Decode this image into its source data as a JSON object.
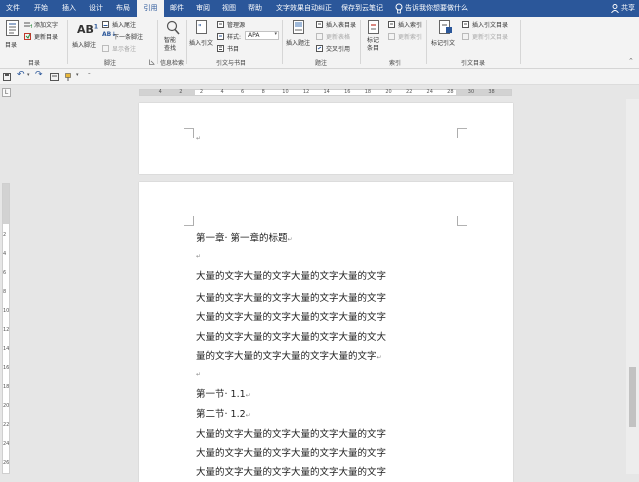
{
  "tabs": [
    "文件",
    "开始",
    "插入",
    "设计",
    "布局",
    "引用",
    "邮件",
    "审阅",
    "视图",
    "帮助",
    "文字效果自动纠正",
    "保存到云笔记"
  ],
  "active_tab": "引用",
  "tell_me": "告诉我你想要做什么",
  "share": "共享",
  "ribbon": {
    "toc": {
      "big": "目录",
      "add_text": "添加文字",
      "update": "更新目录",
      "group": "目录"
    },
    "footnotes": {
      "insert_footnote": "插入脚注",
      "ab_label": "AB",
      "ab_sup": "1",
      "insert_endnote": "插入尾注",
      "next_footnote": "下一条脚注",
      "show_notes": "显示备注",
      "group": "脚注"
    },
    "research": {
      "smart_lookup": "智能查找",
      "group": "信息检索"
    },
    "citations": {
      "insert_citation": "插入引文",
      "manage_sources": "管理源",
      "style_label": "样式:",
      "style_value": "APA",
      "bibliography": "书目",
      "group": "引文与书目"
    },
    "captions": {
      "insert_caption": "插入题注",
      "insert_table_of_figures": "插入表目录",
      "update_table": "更新表格",
      "cross_reference": "交叉引用",
      "group": "题注"
    },
    "index": {
      "mark_entry": "标记条目",
      "insert_index": "插入索引",
      "update_index": "更新索引",
      "group": "索引"
    },
    "toa": {
      "mark_citation": "标记引文",
      "insert_toa": "插入引文目录",
      "update_toa": "更新引文目录",
      "group": "引文目录"
    }
  },
  "ruler_numbers": [
    "4",
    "2",
    "2",
    "4",
    "6",
    "8",
    "10",
    "12",
    "14",
    "16",
    "18",
    "20",
    "22",
    "24",
    "28",
    "30",
    "38"
  ],
  "vruler_numbers": [
    "2",
    "4",
    "6",
    "8",
    "10",
    "12",
    "14",
    "16",
    "18",
    "20",
    "22",
    "24",
    "26"
  ],
  "document": {
    "para_mark": "↵",
    "chapter": "第一章· 第一章的标题",
    "body_line": "大量的文字大量的文字大量的文字大量的文字",
    "body_line_b": "大量的文字大量的文字大量的文字大量的文大",
    "body_last": "量的文字大量的文字大量的文字大量的文字",
    "section1": "第一节· 1.1",
    "section2": "第二节· 1.2",
    "cursor_hint": "L"
  },
  "colors": {
    "brand": "#2b579a",
    "ribbon_bg": "#f3f3f3",
    "canvas": "#e6e6e6"
  }
}
